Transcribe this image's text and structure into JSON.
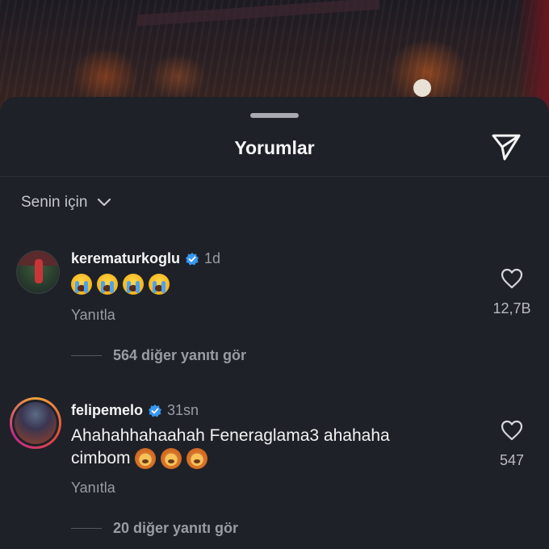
{
  "sheet": {
    "title": "Yorumlar",
    "filter_label": "Senin için"
  },
  "icons": {
    "send": "paper-plane-icon",
    "filter_chevron": "chevron-down-icon",
    "like": "heart-outline-icon",
    "verified": "verified-badge-icon"
  },
  "colors": {
    "sheet_bg": "#1e2128",
    "verified_blue": "#3897f0",
    "secondary_text": "#9a9ca3"
  },
  "comments": [
    {
      "username": "kerematurkoglu",
      "time": "1d",
      "text": "",
      "emojis": [
        "loudly-crying-face",
        "loudly-crying-face",
        "loudly-crying-face",
        "loudly-crying-face"
      ],
      "reply_label": "Yanıtla",
      "more_replies": "564 diğer yanıtı gör",
      "like_count": "12,7B"
    },
    {
      "username": "felipemelo",
      "time": "31sn",
      "text_line1": "Ahahahhahaahah Feneraglama3 ahahaha",
      "text_line2": "cimbom",
      "emojis": [
        "lion-face",
        "lion-face",
        "lion-face"
      ],
      "reply_label": "Yanıtla",
      "more_replies": "20 diğer yanıtı gör",
      "like_count": "547"
    }
  ]
}
